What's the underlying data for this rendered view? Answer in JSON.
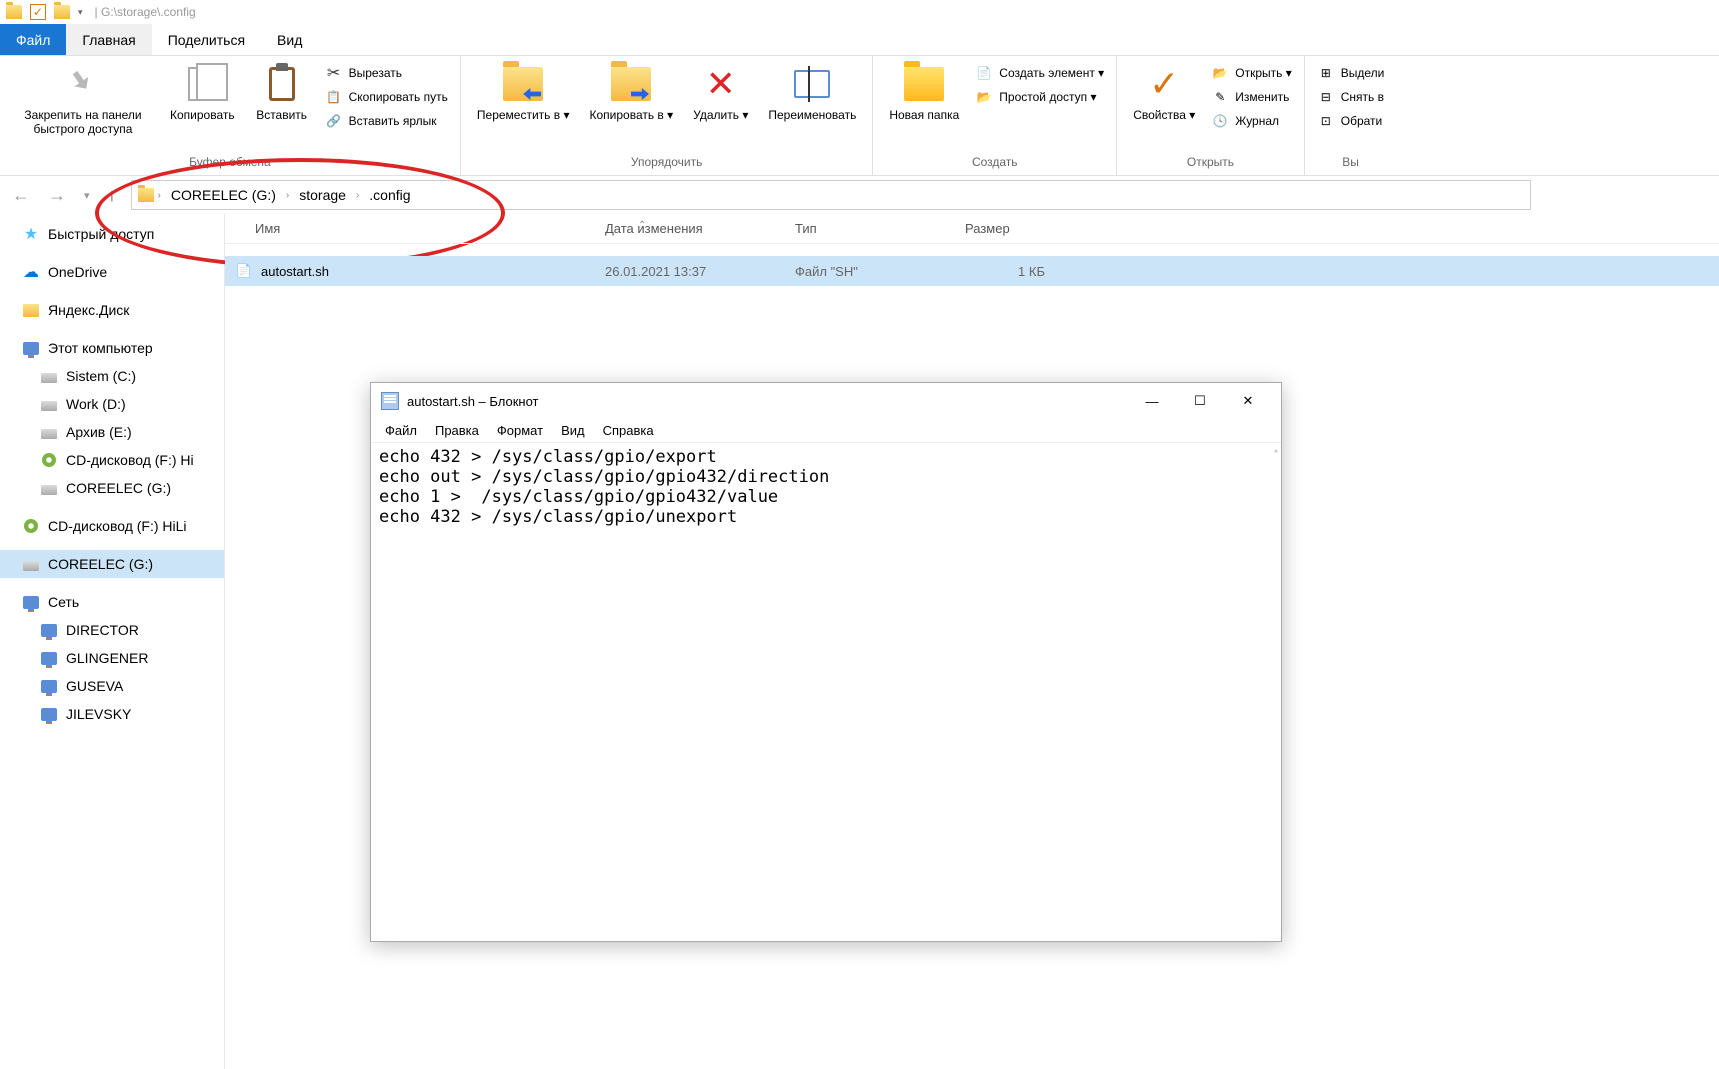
{
  "title_path": "| G:\\storage\\.config",
  "tabs": {
    "file": "Файл",
    "home": "Главная",
    "share": "Поделиться",
    "view": "Вид"
  },
  "ribbon": {
    "clipboard": {
      "label": "Буфер обмена",
      "pin": "Закрепить на панели быстрого доступа",
      "copy": "Копировать",
      "paste": "Вставить",
      "cut": "Вырезать",
      "copy_path": "Скопировать путь",
      "paste_shortcut": "Вставить ярлык"
    },
    "organize": {
      "label": "Упорядочить",
      "move_to": "Переместить в",
      "copy_to": "Копировать в",
      "delete": "Удалить",
      "rename": "Переименовать"
    },
    "new": {
      "label": "Создать",
      "new_folder": "Новая папка",
      "new_item": "Создать элемент",
      "easy_access": "Простой доступ"
    },
    "open": {
      "label": "Открыть",
      "properties": "Свойства",
      "open": "Открыть",
      "edit": "Изменить",
      "history": "Журнал"
    },
    "select": {
      "label": "Вы",
      "select_all": "Выдели",
      "select_none": "Снять в",
      "invert": "Обрати"
    }
  },
  "breadcrumbs": [
    "COREELEC (G:)",
    "storage",
    ".config"
  ],
  "columns": {
    "name": "Имя",
    "date": "Дата изменения",
    "type": "Тип",
    "size": "Размер"
  },
  "file": {
    "name": "autostart.sh",
    "date": "26.01.2021 13:37",
    "type": "Файл \"SH\"",
    "size": "1 КБ"
  },
  "sidebar": {
    "quick": "Быстрый доступ",
    "onedrive": "OneDrive",
    "yandex": "Яндекс.Диск",
    "thispc": "Этот компьютер",
    "drives": [
      "Sistem (C:)",
      "Work (D:)",
      "Архив (E:)",
      "CD-дисковод (F:) Hi",
      "COREELEC (G:)"
    ],
    "cd2": "CD-дисковод (F:) HiLi",
    "coreelec2": "COREELEC (G:)",
    "network": "Сеть",
    "net_items": [
      "DIRECTOR",
      "GLINGENER",
      "GUSEVA",
      "JILEVSKY"
    ]
  },
  "notepad": {
    "title": "autostart.sh – Блокнот",
    "menu": {
      "file": "Файл",
      "edit": "Правка",
      "format": "Формат",
      "view": "Вид",
      "help": "Справка"
    },
    "content": "echo 432 > /sys/class/gpio/export\necho out > /sys/class/gpio/gpio432/direction\necho 1 >  /sys/class/gpio/gpio432/value\necho 432 > /sys/class/gpio/unexport"
  }
}
